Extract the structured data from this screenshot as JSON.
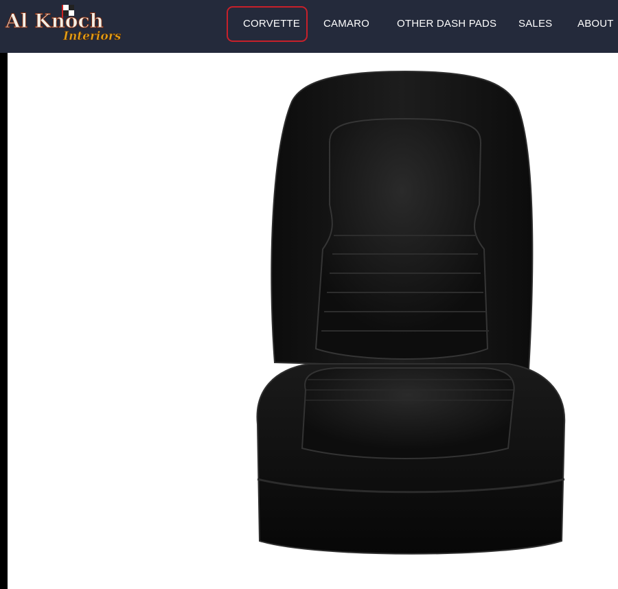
{
  "logo": {
    "line1": "Al Knoch",
    "line2": "Interiors"
  },
  "nav": {
    "items": [
      {
        "label": "CORVETTE",
        "highlighted": true
      },
      {
        "label": "CAMARO"
      },
      {
        "label": "OTHER DASH PADS"
      },
      {
        "label": "SALES"
      },
      {
        "label": "ABOUT"
      }
    ]
  },
  "colors": {
    "navbar": "#242a3b",
    "highlight": "#c8202a",
    "logo_primary": "#f2efe6",
    "logo_accent": "#e3a21c"
  },
  "product": {
    "image": "black-leather-bucket-seat"
  }
}
